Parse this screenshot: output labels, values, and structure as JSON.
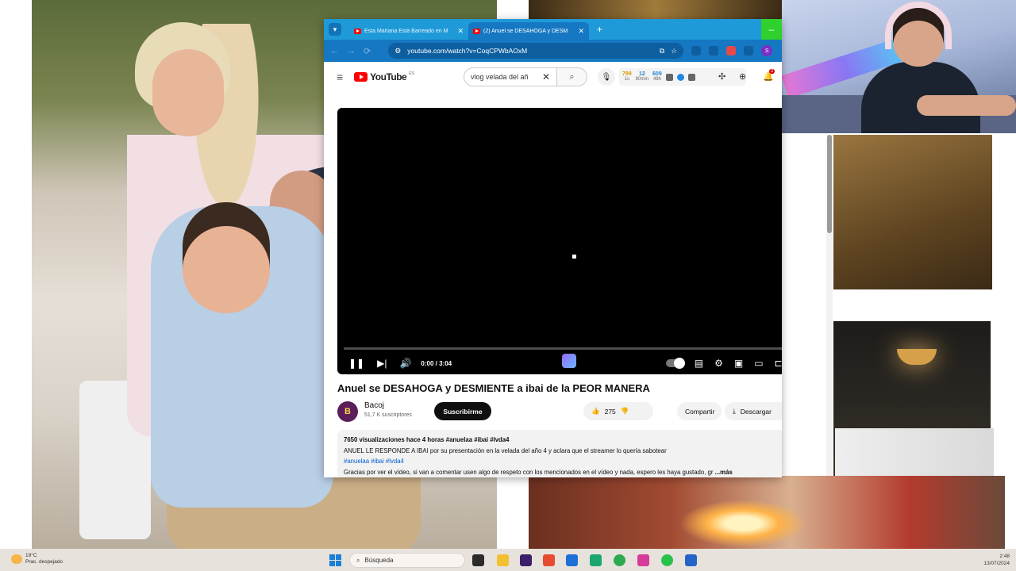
{
  "browser": {
    "tabs": [
      {
        "title": "Esta Mañana Está Barreado en M"
      },
      {
        "title": "(2) Anuel se DESAHOGA y DESM"
      }
    ],
    "new_tab_symbol": "+",
    "close_symbol": "✕",
    "url": "youtube.com/watch?v=CoqCPWbAOxM",
    "profile_initial": "S"
  },
  "youtube": {
    "logo_text": "YouTube",
    "country_code": "ES",
    "search_value": "vlog velada del añ",
    "notification_count": "2",
    "ext_stats": [
      {
        "value": "799",
        "unit": "1s"
      },
      {
        "value": "12",
        "unit": "80min"
      },
      {
        "value": "609",
        "unit": "48h"
      }
    ],
    "player": {
      "time": "0:00 / 3:04",
      "progress": 0
    },
    "video_title": "Anuel se DESAHOGA y DESMIENTE a ibai de la PEOR MANERA",
    "channel": {
      "avatar_letter": "B",
      "name": "Bacoj",
      "subscribers": "51,7 K suscriptores",
      "subscribe_label": "Suscribirme"
    },
    "actions": {
      "likes": "275",
      "share": "Compartir",
      "download": "Descargar",
      "more": "···"
    },
    "description": {
      "meta": "7650 visualizaciones  hace 4 horas",
      "meta_tags": "#anuelaa #ibai #lvda4",
      "line1": "ANUEL LE RESPONDE A IBAI por su presentación en la velada del año 4 y aclara que el streamer lo quería sabotear",
      "line2_tags": "#anuelaa #ibai #lvda4",
      "line3": "Gracias por ver el vídeo, si van a comentar usen algo de respeto con los mencionados en el vídeo y nada, espero les haya gustado, gr",
      "more": "...más"
    }
  },
  "taskbar": {
    "weather_temp": "19°C",
    "weather_desc": "Prac. despejado",
    "search_placeholder": "Búsqueda",
    "time": "2:48",
    "date": "13/07/2024"
  },
  "colors": {
    "tabbar": "#1f9ad8",
    "toolbar": "#1677c2",
    "youtube_red": "#ff0000",
    "subscribe_bg": "#0f0f0f",
    "hashtag": "#065fd4"
  }
}
